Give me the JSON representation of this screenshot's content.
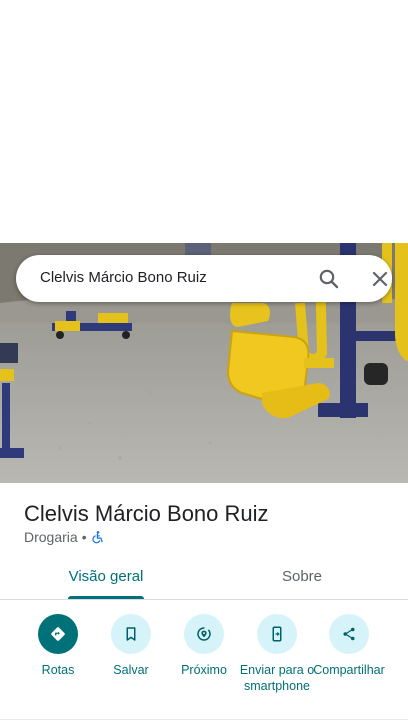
{
  "search": {
    "query": "Clelvis Márcio Bono Ruiz"
  },
  "place": {
    "title": "Clelvis Márcio Bono Ruiz",
    "category": "Drogaria",
    "separator": "•"
  },
  "tabs": [
    {
      "label": "Visão geral",
      "active": true
    },
    {
      "label": "Sobre",
      "active": false
    }
  ],
  "actions": [
    {
      "label": "Rotas",
      "icon": "directions-icon"
    },
    {
      "label": "Salvar",
      "icon": "bookmark-icon"
    },
    {
      "label": "Próximo",
      "icon": "nearby-icon"
    },
    {
      "label": "Enviar para o smartphone",
      "icon": "send-to-phone-icon"
    },
    {
      "label": "Compartilhar",
      "icon": "share-icon"
    }
  ],
  "colors": {
    "accent": "#007079",
    "action_bg": "#d5f3f8",
    "accessible": "#1a73e8"
  }
}
